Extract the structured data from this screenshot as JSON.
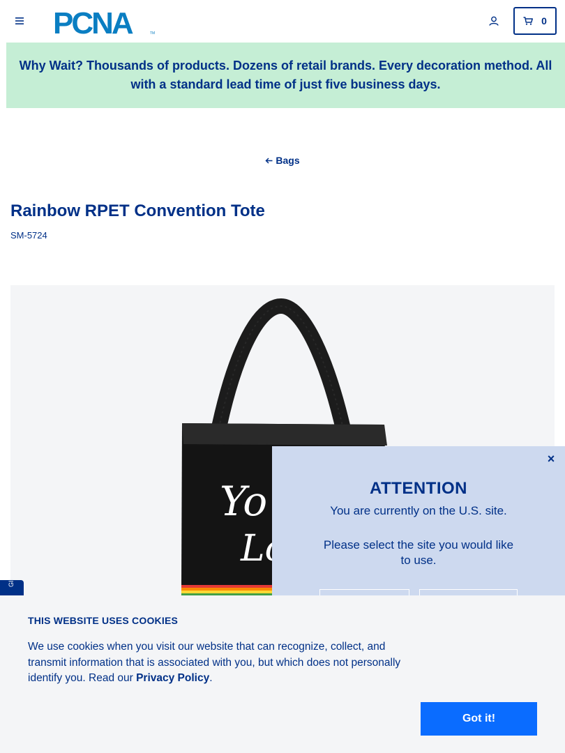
{
  "header": {
    "menu_icon": "hamburger-menu-icon",
    "logo_text": "PCNA",
    "logo_tm": "TM",
    "account_icon": "user-icon",
    "cart_icon": "shopping-cart-icon",
    "cart_count": "0"
  },
  "promo": {
    "text": "Why Wait? Thousands of products. Dozens of retail brands. Every decoration method. All with a standard lead time of just five business days."
  },
  "breadcrumb": {
    "back_label": "Bags",
    "arrow_icon": "arrow-left-icon"
  },
  "product": {
    "title": "Rainbow RPET Convention Tote",
    "sku": "SM-5724",
    "image_alt": "Rainbow RPET Convention Tote"
  },
  "site_modal": {
    "close_symbol": "×",
    "title": "ATTENTION",
    "line1": "You are currently on the U.S. site.",
    "line2": "Please select the site you would like to use."
  },
  "feedback_tab": {
    "label": "GI"
  },
  "cookie_notice": {
    "title": "THIS WEBSITE USES COOKIES",
    "text": "We use cookies when you visit our website that can recognize, collect, and transmit information that is associated with you, but which does not personally identify you. Read our ",
    "link_text": "Privacy Policy",
    "text_end": ".",
    "accept_label": "Got it!"
  },
  "colors": {
    "brand_navy": "#003087",
    "banner_green": "#c5eed5",
    "modal_bg": "#cdd9ef",
    "cookie_button": "#0a6cff",
    "cookie_bg": "#f4f5f7"
  }
}
